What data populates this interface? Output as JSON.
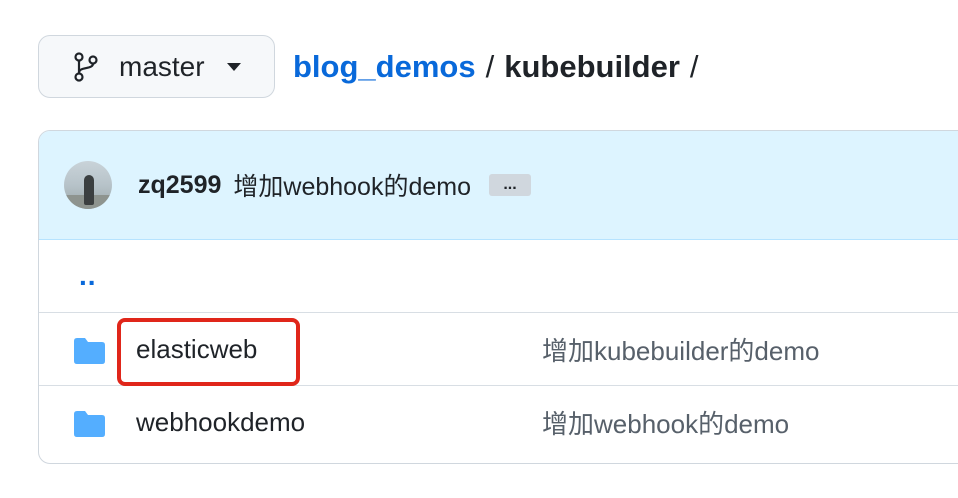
{
  "branch": {
    "label": "master",
    "icon": "git-branch-icon"
  },
  "breadcrumb": {
    "repo": "blog_demos",
    "separator": "/",
    "folder": "kubebuilder",
    "trailing_separator": "/"
  },
  "latest_commit": {
    "author": "zq2599",
    "message": "增加webhook的demo",
    "more_label": "..."
  },
  "files": {
    "parent_link": "..",
    "items": [
      {
        "name": "elasticweb",
        "type": "folder",
        "commit_message": "增加kubebuilder的demo"
      },
      {
        "name": "webhookdemo",
        "type": "folder",
        "commit_message": "增加webhook的demo"
      }
    ]
  },
  "colors": {
    "link": "#0969da",
    "commit_bar": "#ddf4ff",
    "folder": "#54aeff",
    "highlight": "#e0261a"
  }
}
